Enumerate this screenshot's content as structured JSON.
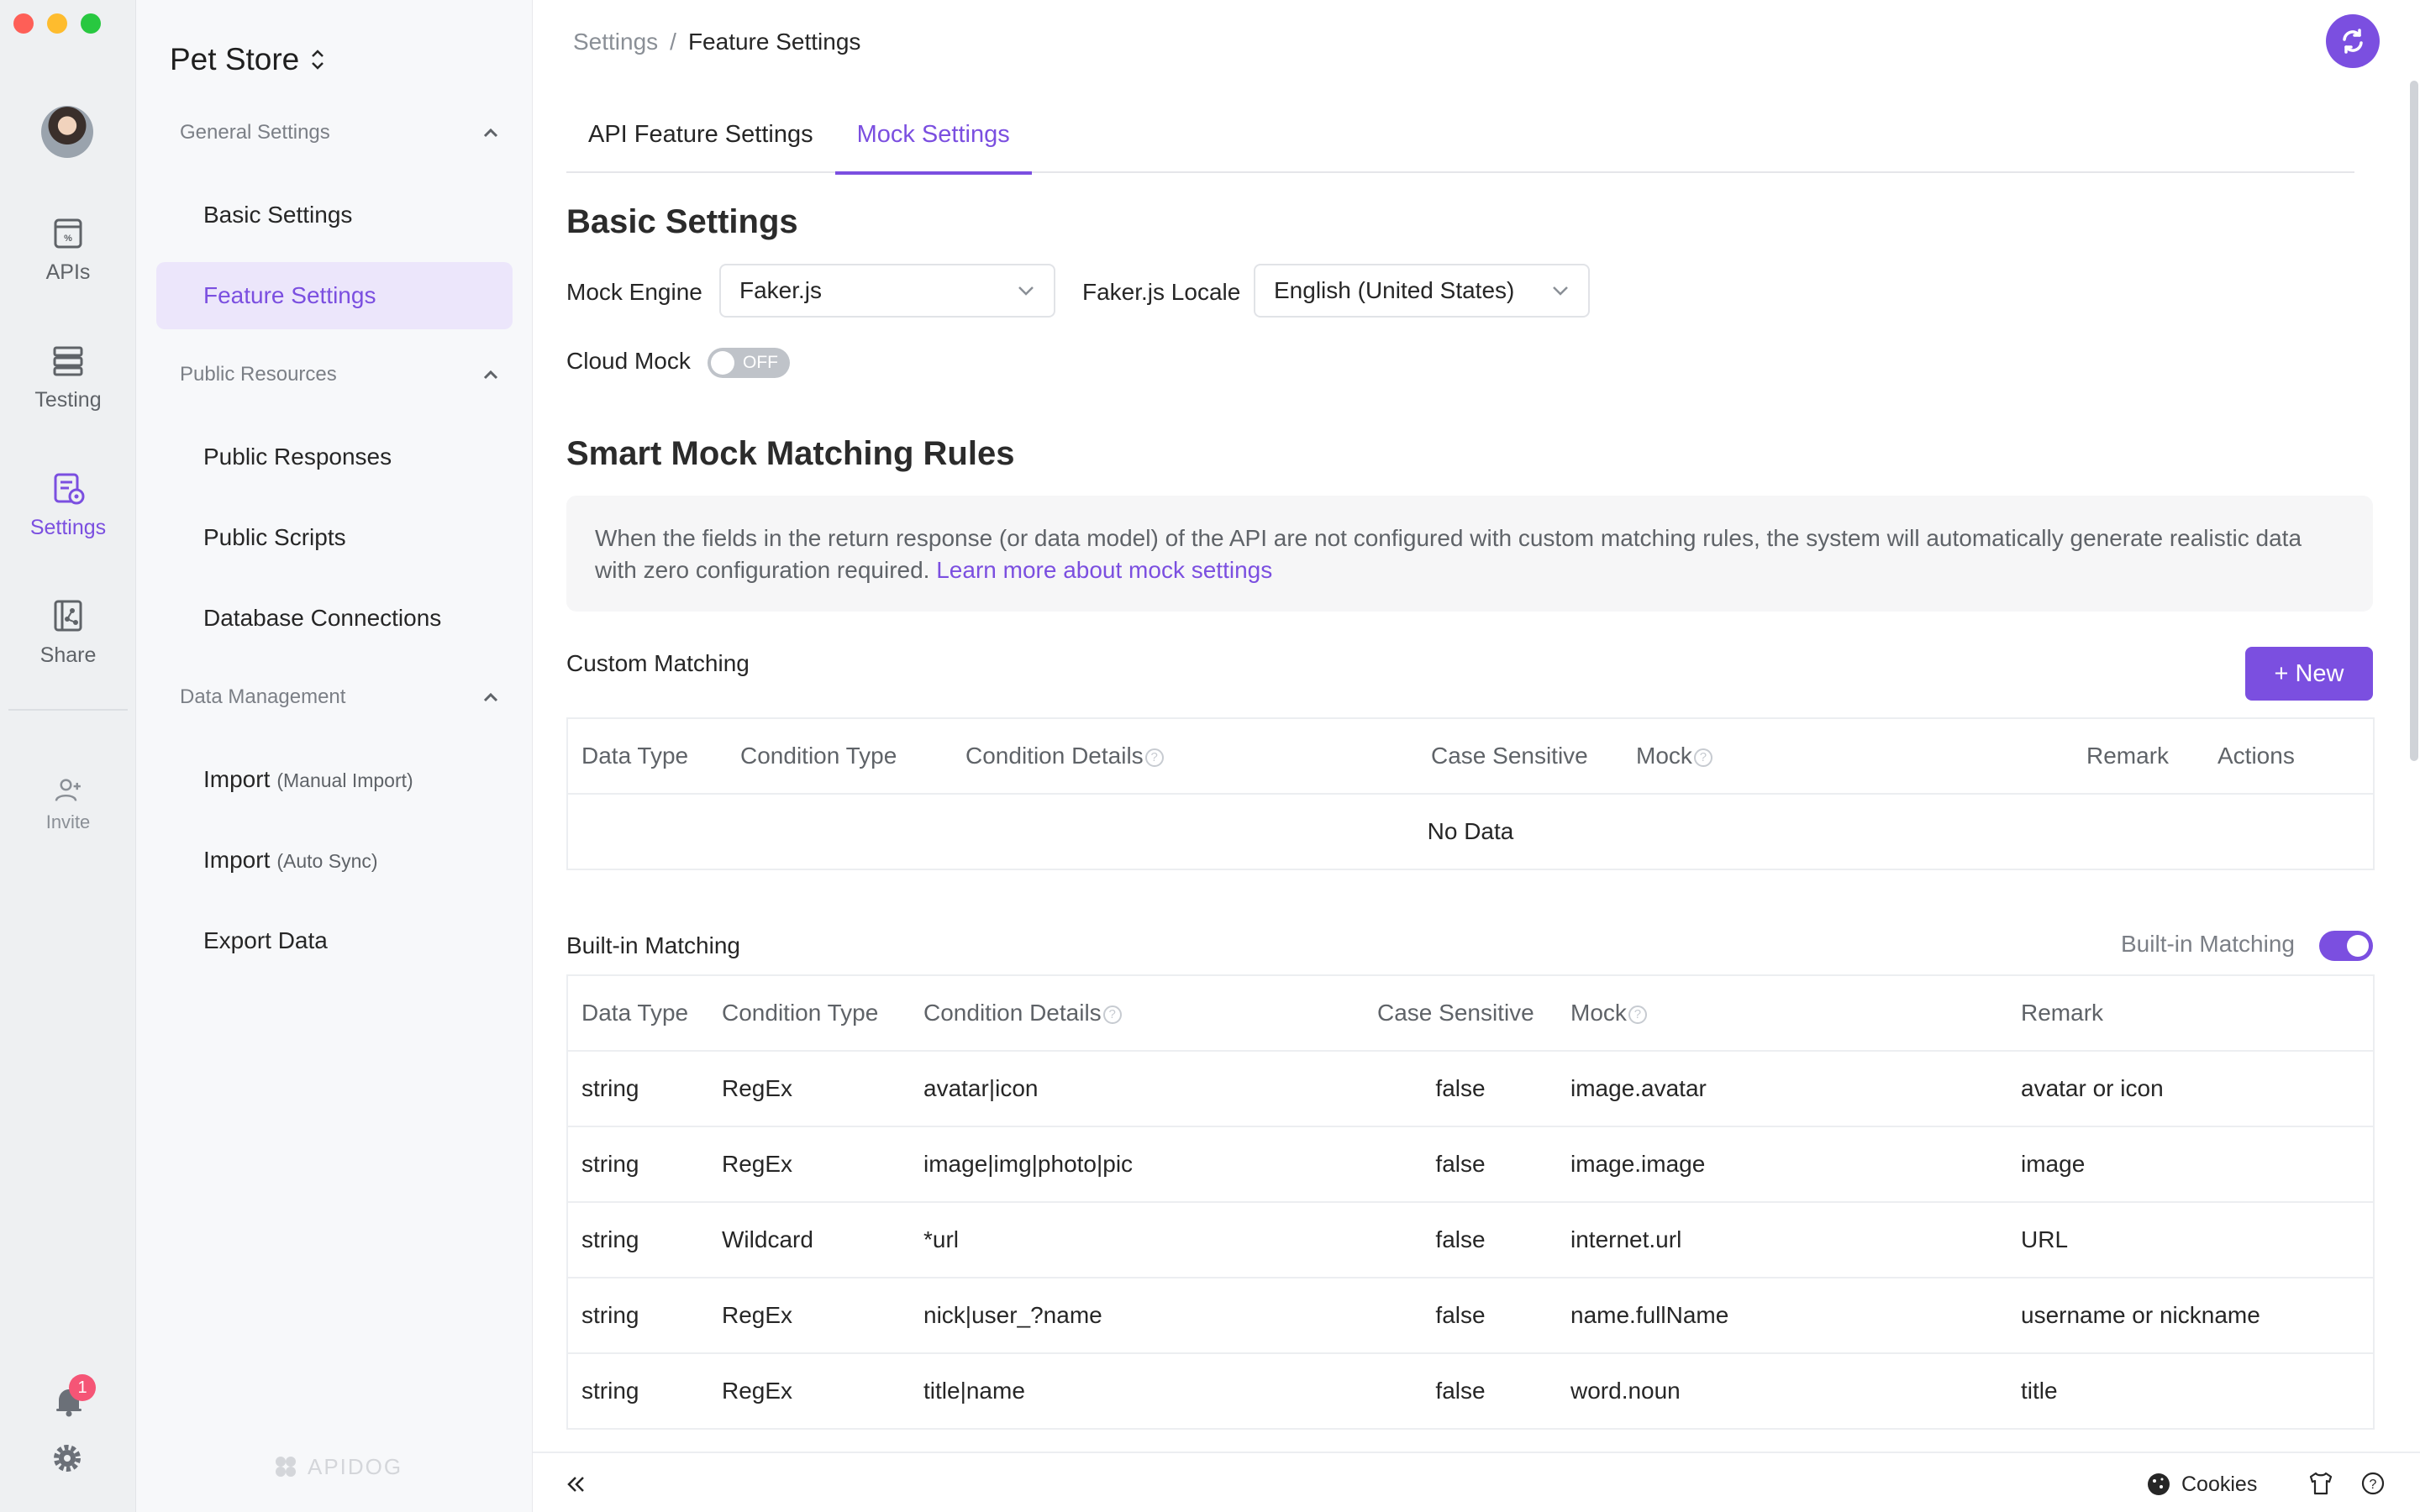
{
  "rail": {
    "items": [
      {
        "label": "APIs",
        "icon": "apis-icon"
      },
      {
        "label": "Testing",
        "icon": "testing-icon"
      },
      {
        "label": "Settings",
        "icon": "settings-icon"
      },
      {
        "label": "Share",
        "icon": "share-icon"
      },
      {
        "label": "Invite",
        "icon": "invite-icon"
      }
    ],
    "notification_count": "1",
    "accent": "#7b4fe0"
  },
  "sidebar": {
    "project": "Pet Store",
    "sections": [
      {
        "title": "General Settings",
        "items": [
          "Basic Settings",
          "Feature Settings"
        ]
      },
      {
        "title": "Public Resources",
        "items": [
          "Public Responses",
          "Public Scripts",
          "Database Connections"
        ]
      },
      {
        "title": "Data Management"
      }
    ],
    "data_items": [
      {
        "label": "Import",
        "sub": "(Manual Import)"
      },
      {
        "label": "Import",
        "sub": "(Auto Sync)"
      },
      {
        "label": "Export Data",
        "sub": ""
      }
    ],
    "logo_text": "APIDOG"
  },
  "breadcrumb": {
    "root": "Settings",
    "sep": "/",
    "current": "Feature Settings"
  },
  "tabs": [
    "API Feature Settings",
    "Mock Settings"
  ],
  "basic": {
    "title": "Basic Settings",
    "mock_engine_label": "Mock Engine",
    "mock_engine_value": "Faker.js",
    "locale_label": "Faker.js Locale",
    "locale_value": "English (United States)",
    "cloud_mock_label": "Cloud Mock",
    "cloud_mock_state": "OFF"
  },
  "smart": {
    "title": "Smart Mock Matching Rules",
    "info": "When the fields in the return response (or data model) of the API are not configured with custom matching rules, the system will automatically generate realistic data with zero configuration required.",
    "link": "Learn more about mock settings"
  },
  "custom": {
    "title": "Custom Matching",
    "new_button": "New",
    "columns": [
      "Data Type",
      "Condition Type",
      "Condition Details",
      "Case Sensitive",
      "Mock",
      "Remark",
      "Actions"
    ],
    "empty_text": "No Data"
  },
  "builtin": {
    "title": "Built-in Matching",
    "toggle_label": "Built-in Matching",
    "enabled": true,
    "columns": [
      "Data Type",
      "Condition Type",
      "Condition Details",
      "Case Sensitive",
      "Mock",
      "Remark"
    ],
    "rows": [
      {
        "type": "string",
        "cond": "RegEx",
        "details": "avatar|icon",
        "case": "false",
        "mock": "image.avatar",
        "remark": "avatar or icon"
      },
      {
        "type": "string",
        "cond": "RegEx",
        "details": "image|img|photo|pic",
        "case": "false",
        "mock": "image.image",
        "remark": "image"
      },
      {
        "type": "string",
        "cond": "Wildcard",
        "details": "*url",
        "case": "false",
        "mock": "internet.url",
        "remark": "URL"
      },
      {
        "type": "string",
        "cond": "RegEx",
        "details": "nick|user_?name",
        "case": "false",
        "mock": "name.fullName",
        "remark": "username or nickname"
      },
      {
        "type": "string",
        "cond": "RegEx",
        "details": "title|name",
        "case": "false",
        "mock": "word.noun",
        "remark": "title"
      }
    ]
  },
  "footer": {
    "cookies": "Cookies"
  }
}
